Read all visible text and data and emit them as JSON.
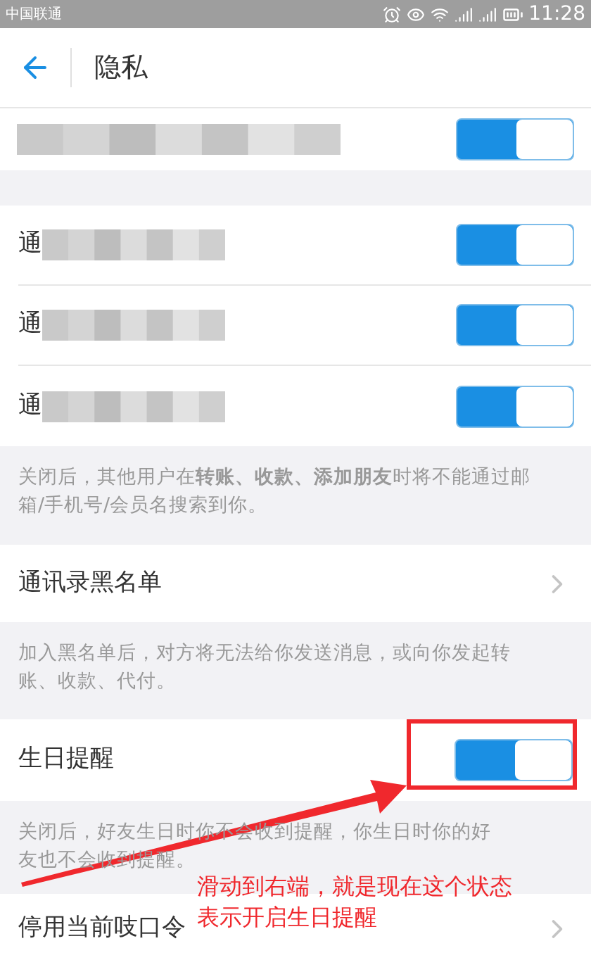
{
  "status_bar": {
    "carrier": "中国联通",
    "time": "11:28"
  },
  "header": {
    "title": "隐私"
  },
  "top_row": {
    "on": true
  },
  "contact_rows": [
    {
      "label": "通",
      "on": true
    },
    {
      "label": "通",
      "on": true
    },
    {
      "label": "通",
      "on": true
    }
  ],
  "contact_note": "关闭后，其他用户在**转账、收款、添加朋友**时将不能通过邮箱/手机号/会员名搜索到你。",
  "blacklist": {
    "label": "通讯录黑名单",
    "note": "加入黑名单后，对方将无法给你发送消息，或向你发起转账、收款、代付。"
  },
  "birthday": {
    "label": "生日提醒",
    "on": true,
    "note": "关闭后，好友生日时你不会收到提醒，你生日时你的好友也不会收到提醒。"
  },
  "last_row": {
    "label": "停用当前吱口令"
  },
  "annotation": {
    "lines": [
      "滑动到右端，就是现在这个状态",
      "表示开启生日提醒"
    ]
  }
}
